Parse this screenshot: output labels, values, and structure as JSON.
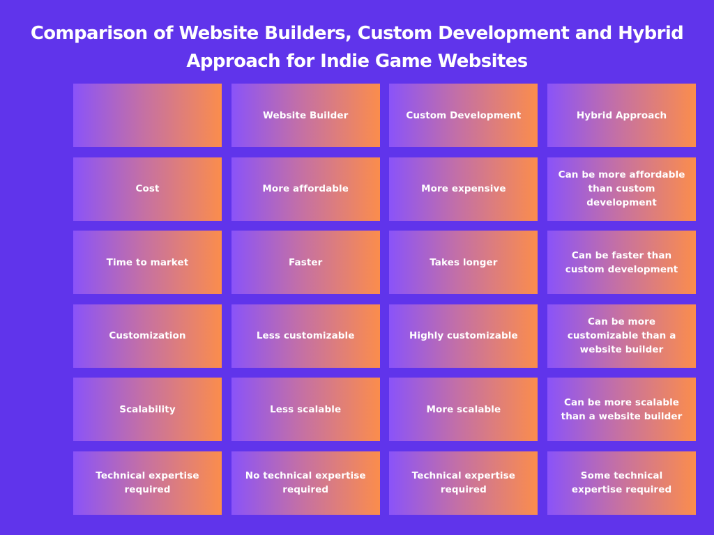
{
  "title": "Comparison of Website Builders, Custom Development and Hybrid Approach for Indie Game Websites",
  "table": {
    "headers": [
      "",
      "Website Builder",
      "Custom Development",
      "Hybrid Approach"
    ],
    "rows": [
      [
        "Cost",
        "More affordable",
        "More expensive",
        "Can be more affordable than custom development"
      ],
      [
        "Time to market",
        "Faster",
        "Takes longer",
        "Can be faster than custom development"
      ],
      [
        "Customization",
        "Less customizable",
        "Highly customizable",
        "Can be more customizable than a website builder"
      ],
      [
        "Scalability",
        "Less scalable",
        "More scalable",
        "Can be more scalable than a website builder"
      ],
      [
        "Technical expertise required",
        "No technical expertise required",
        "Technical expertise required",
        "Some technical expertise required"
      ]
    ]
  },
  "colors": {
    "background": "#6034EB",
    "gradient_start": "#8A53F9",
    "gradient_end": "#FB8D4C",
    "text": "#FFFFFF"
  }
}
